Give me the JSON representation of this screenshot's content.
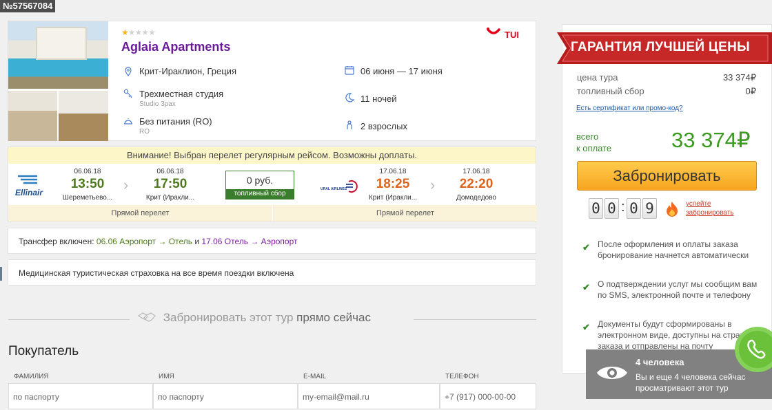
{
  "order_id": "№57567084",
  "hotel": {
    "stars_filled": 1,
    "stars_total": 5,
    "name": "Aglaia Apartments",
    "operator": "TUI",
    "location": "Крит-Ираклион, Греция",
    "room": "Трехместная студия",
    "room_sub": "Studio 3pax",
    "meal": "Без питания (RO)",
    "meal_sub": "RO",
    "dates": "06 июня — 17 июня",
    "nights": "11 ночей",
    "guests": "2 взрослых"
  },
  "flight": {
    "warning": "Внимание! Выбран перелет регулярным рейсом. Возможны доплаты.",
    "outbound": {
      "airline": "Ellinair",
      "dep_date": "06.06.18",
      "dep_time": "13:50",
      "dep_city": "Шереметьево...",
      "arr_date": "06.06.18",
      "arr_time": "17:50",
      "arr_city": "Крит (Иракли..."
    },
    "fuel": {
      "amount": "0 руб.",
      "label": "топливный сбор"
    },
    "return": {
      "airline": "URAL AIRLINES",
      "dep_date": "17.06.18",
      "dep_time": "18:25",
      "dep_city": "Крит (Иракли...",
      "arr_date": "17.06.18",
      "arr_time": "22:20",
      "arr_city": "Домодедово"
    },
    "direct_left": "Прямой перелет",
    "direct_right": "Прямой перелет"
  },
  "transfer": {
    "prefix": "Трансфер включен:",
    "out_date": "06.06",
    "out_route": "Аэропорт → Отель",
    "and": "и",
    "back_date": "17.06",
    "back_route": "Отель → Аэропорт"
  },
  "insurance": "Медицинская туристическая страховка на все время поездки включена",
  "book_now": {
    "part1": "Забронировать этот тур",
    "part2": "прямо сейчас"
  },
  "buyer": {
    "title": "Покупатель",
    "columns": [
      "Фамилия",
      "Имя",
      "E-mail",
      "Телефон"
    ],
    "placeholders": [
      "по паспорту",
      "по паспорту",
      "my-email@mail.ru",
      "+7 (917) 000-00-00"
    ]
  },
  "price_panel": {
    "guarantee": "ГАРАНТИЯ ЛУЧШЕЙ ЦЕНЫ",
    "tour_price_label": "цена тура",
    "tour_price": "33 374₽",
    "fuel_label": "топливный сбор",
    "fuel_value": "0₽",
    "promo_link": "Есть сертификат или промо-код?",
    "total_label_1": "всего",
    "total_label_2": "к оплате",
    "total": "33 374₽",
    "book_button": "Забронировать",
    "timer_digits": [
      "0",
      "0",
      "0",
      "9"
    ],
    "timer_link_1": "успейте",
    "timer_link_2": "забронировать",
    "bullets": [
      "После оформления и оплаты заказа бронирование начнется автоматически",
      "О подтверждении услуг мы сообщим вам по SMS, электронной почте и телефону",
      "Документы будут сформированы в электронном виде, доступны на странице заказа и отправлены на почту"
    ]
  },
  "viewers": {
    "count": "4 человека",
    "text": "Вы и еще 4 человека сейчас просматривают этот тур"
  },
  "colors": {
    "hotel_name": "#6a1b9a",
    "outbound_time": "#4e7a1c",
    "return_time": "#e0641b",
    "total": "#3a9a1f",
    "ribbon": "#b71c1c",
    "book_button": "#f7a520"
  }
}
